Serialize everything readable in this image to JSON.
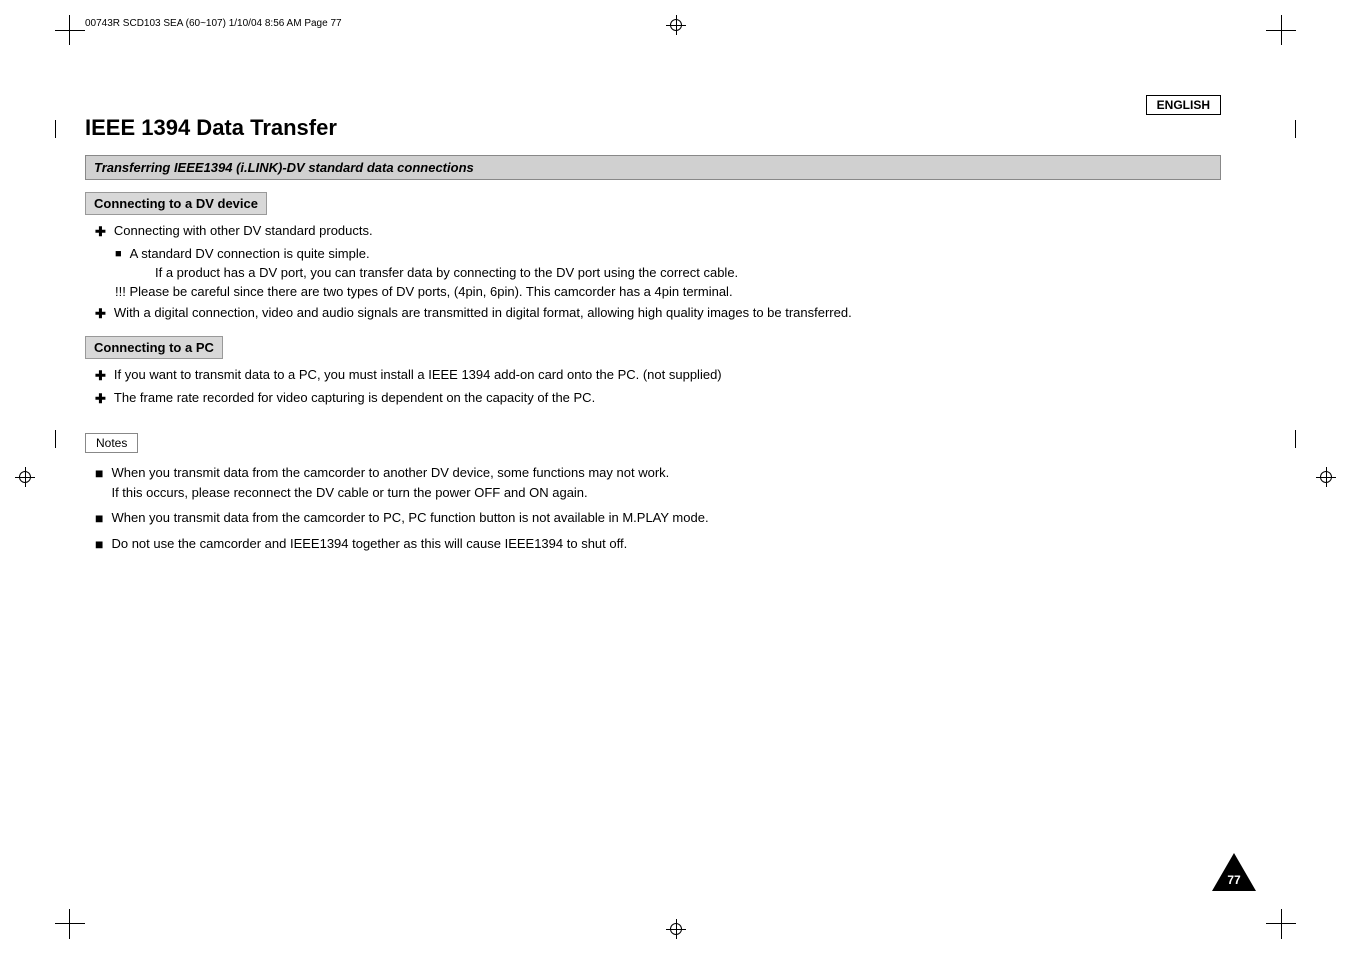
{
  "header": {
    "meta_text": "00743R SCD103 SEA (60~107)   1/10/04 8:56 AM   Page 77",
    "language": "ENGLISH"
  },
  "page": {
    "title": "IEEE 1394 Data Transfer",
    "section_heading": "Transferring IEEE1394 (i.LINK)-DV standard data connections",
    "subsection1": {
      "title": "Connecting to a DV device",
      "bullets": [
        {
          "type": "plus",
          "text": "Connecting with other DV standard products.",
          "sub_bullets": [
            {
              "type": "square",
              "text": "A standard DV connection is quite simple."
            },
            {
              "type": "indent",
              "text": "If a product has a DV port, you can transfer data by connecting to the DV port using the correct cable."
            },
            {
              "type": "excl",
              "text": "!!!   Please be careful since there are two types of DV ports, (4pin, 6pin). This camcorder has a 4pin terminal."
            }
          ]
        },
        {
          "type": "plus",
          "text": "With a digital connection, video and audio signals are transmitted in digital format, allowing high quality images to be transferred."
        }
      ]
    },
    "subsection2": {
      "title": "Connecting to a PC",
      "bullets": [
        {
          "type": "plus",
          "text": "If you want to transmit data to a PC, you must install a IEEE 1394 add-on card onto the PC. (not supplied)"
        },
        {
          "type": "plus",
          "text": "The frame rate recorded for video capturing is dependent on the capacity of the PC."
        }
      ]
    },
    "notes_label": "Notes",
    "notes": [
      {
        "text": "When you transmit data from the camcorder to another DV device, some functions may not work.\nIf this occurs, please reconnect the DV cable or turn the power OFF and ON again."
      },
      {
        "text": "When you transmit data from the camcorder to PC, PC function button is not available in M.PLAY mode."
      },
      {
        "text": "Do not use the camcorder and IEEE1394 together as this will cause IEEE1394 to shut off."
      }
    ],
    "page_number": "77"
  }
}
